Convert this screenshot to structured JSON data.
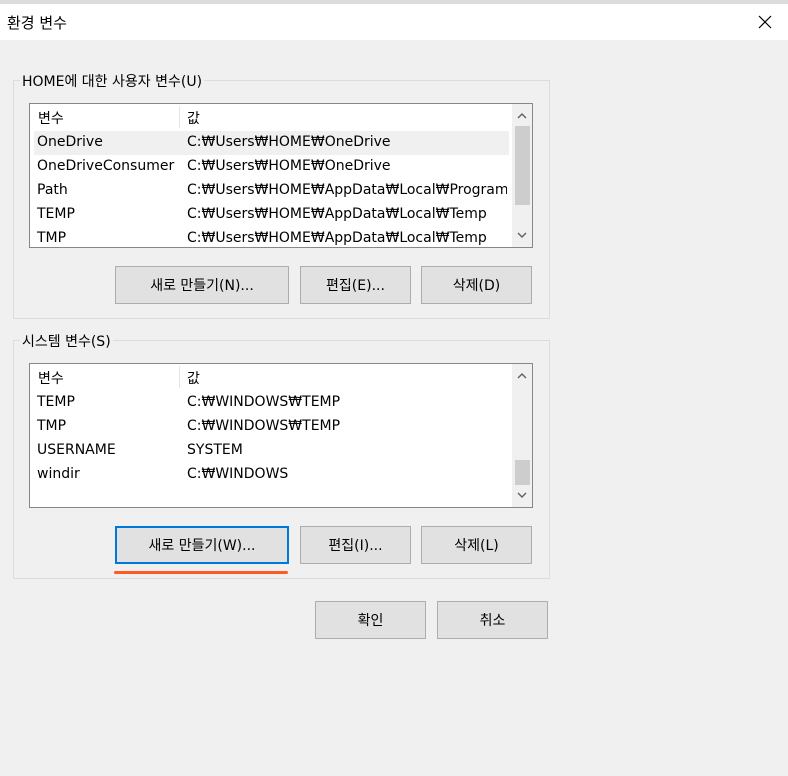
{
  "dialog": {
    "title": "환경 변수"
  },
  "user_vars": {
    "group_label": "HOME에 대한 사용자 변수(U)",
    "columns": [
      "변수",
      "값"
    ],
    "rows": [
      {
        "name": "OneDrive",
        "value": "C:₩Users₩HOME₩OneDrive",
        "selected": true
      },
      {
        "name": "OneDriveConsumer",
        "value": "C:₩Users₩HOME₩OneDrive"
      },
      {
        "name": "Path",
        "value": "C:₩Users₩HOME₩AppData₩Local₩Programs..."
      },
      {
        "name": "TEMP",
        "value": "C:₩Users₩HOME₩AppData₩Local₩Temp"
      },
      {
        "name": "TMP",
        "value": "C:₩Users₩HOME₩AppData₩Local₩Temp"
      }
    ],
    "buttons": {
      "new": "새로 만들기(N)...",
      "edit": "편집(E)...",
      "delete": "삭제(D)"
    }
  },
  "system_vars": {
    "group_label": "시스템 변수(S)",
    "columns": [
      "변수",
      "값"
    ],
    "rows": [
      {
        "name": "TEMP",
        "value": "C:₩WINDOWS₩TEMP"
      },
      {
        "name": "TMP",
        "value": "C:₩WINDOWS₩TEMP"
      },
      {
        "name": "USERNAME",
        "value": "SYSTEM"
      },
      {
        "name": "windir",
        "value": "C:₩WINDOWS"
      }
    ],
    "buttons": {
      "new": "새로 만들기(W)...",
      "edit": "편집(I)...",
      "delete": "삭제(L)"
    }
  },
  "footer": {
    "ok": "확인",
    "cancel": "취소"
  },
  "colors": {
    "focus_border": "#0078d7",
    "annotation_underline": "#ff5a1f",
    "selected_row": "#f0f0f0"
  }
}
